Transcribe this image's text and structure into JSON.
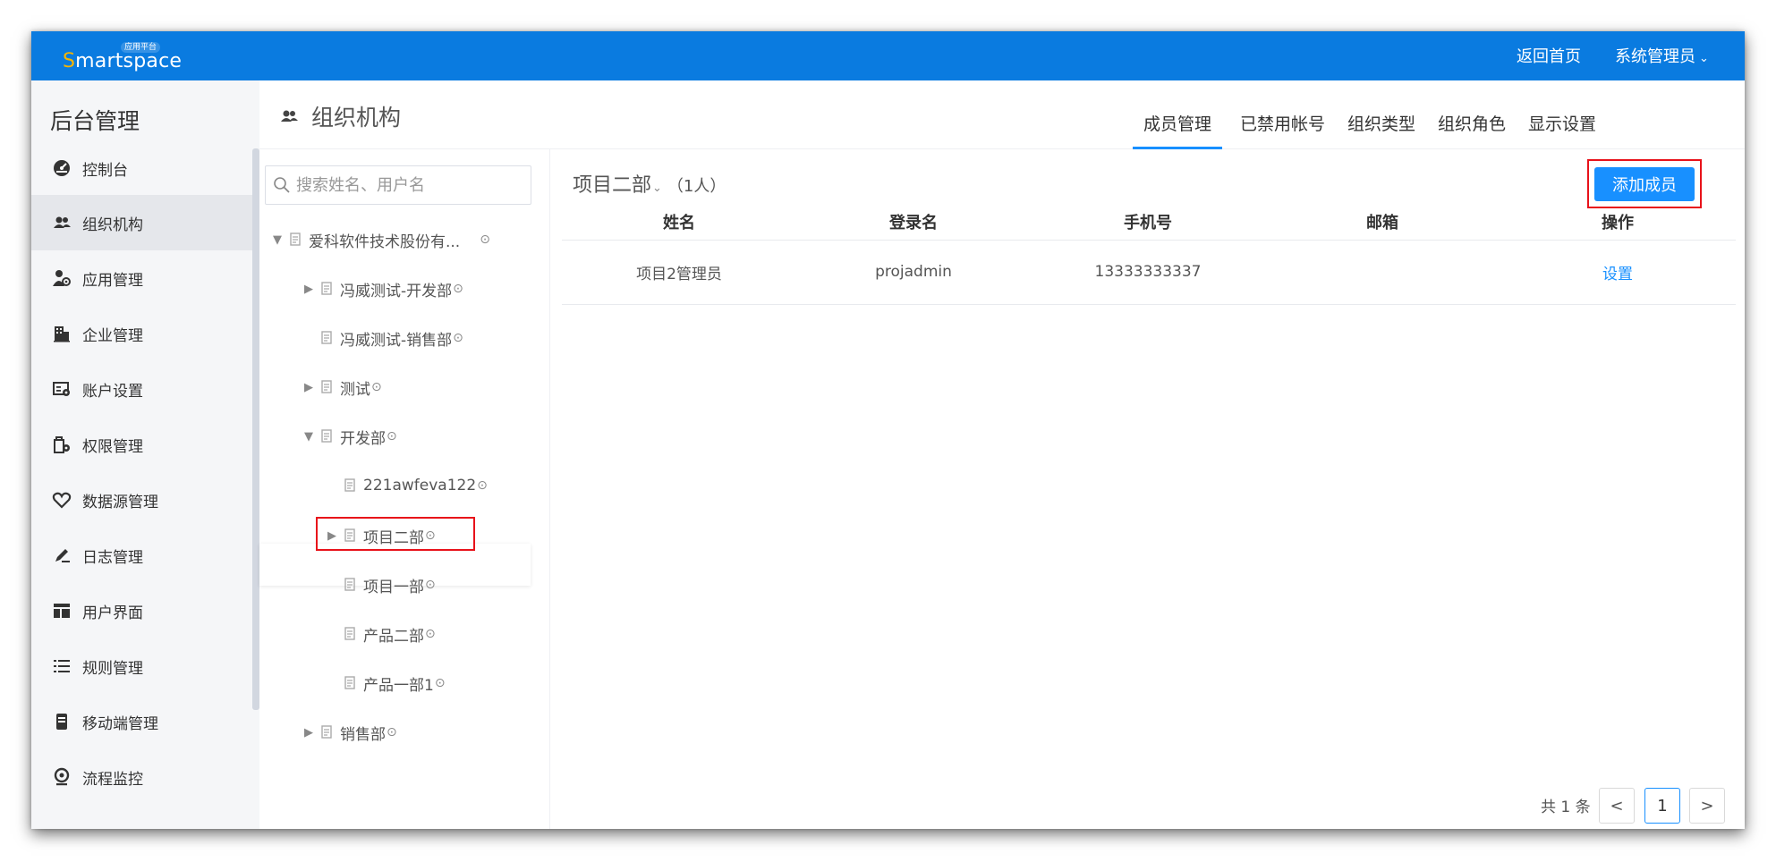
{
  "header": {
    "logo_text_first": "S",
    "logo_text_rest": "martspace",
    "logo_tag": "应用平台",
    "home_link": "返回首页",
    "user_menu": "系统管理员"
  },
  "sidebar": {
    "title": "后台管理",
    "items": [
      {
        "label": "控制台",
        "icon": "dashboard-icon"
      },
      {
        "label": "组织机构",
        "icon": "users-icon",
        "active": true
      },
      {
        "label": "应用管理",
        "icon": "app-user-icon"
      },
      {
        "label": "企业管理",
        "icon": "building-icon"
      },
      {
        "label": "账户设置",
        "icon": "account-settings-icon"
      },
      {
        "label": "权限管理",
        "icon": "permission-icon"
      },
      {
        "label": "数据源管理",
        "icon": "heart-icon"
      },
      {
        "label": "日志管理",
        "icon": "pen-icon"
      },
      {
        "label": "用户界面",
        "icon": "layout-icon"
      },
      {
        "label": "规则管理",
        "icon": "list-icon"
      },
      {
        "label": "移动端管理",
        "icon": "mobile-icon"
      },
      {
        "label": "流程监控",
        "icon": "monitor-icon"
      }
    ]
  },
  "org": {
    "title": "组织机构",
    "tabs": [
      "成员管理",
      "已禁用帐号",
      "组织类型",
      "组织角色",
      "显示设置"
    ],
    "active_tab": "成员管理"
  },
  "tree": {
    "search_placeholder": "搜索姓名、用户名",
    "nodes": [
      {
        "label": "爱科软件技术股份有...",
        "expanded": true
      },
      {
        "label": "冯威测试-开发部",
        "expandable": true
      },
      {
        "label": "冯威测试-销售部"
      },
      {
        "label": "测试",
        "expandable": true
      },
      {
        "label": "开发部",
        "expanded": true
      },
      {
        "label": "221awfeva122"
      },
      {
        "label": "项目二部",
        "expandable": true,
        "selected": true
      },
      {
        "label": "项目一部"
      },
      {
        "label": "产品二部"
      },
      {
        "label": "产品一部1"
      },
      {
        "label": "销售部",
        "expandable": true
      }
    ]
  },
  "content": {
    "dept_name": "项目二部",
    "member_count": "（1人）",
    "add_button": "添加成员",
    "columns": [
      "姓名",
      "登录名",
      "手机号",
      "邮箱",
      "操作"
    ],
    "rows": [
      {
        "name": "项目2管理员",
        "login": "projadmin",
        "phone": "13333333337",
        "email": "",
        "action": "设置"
      }
    ],
    "pagination": {
      "total_text": "共 1 条",
      "current_page": "1",
      "prev": "<",
      "next": ">"
    }
  }
}
